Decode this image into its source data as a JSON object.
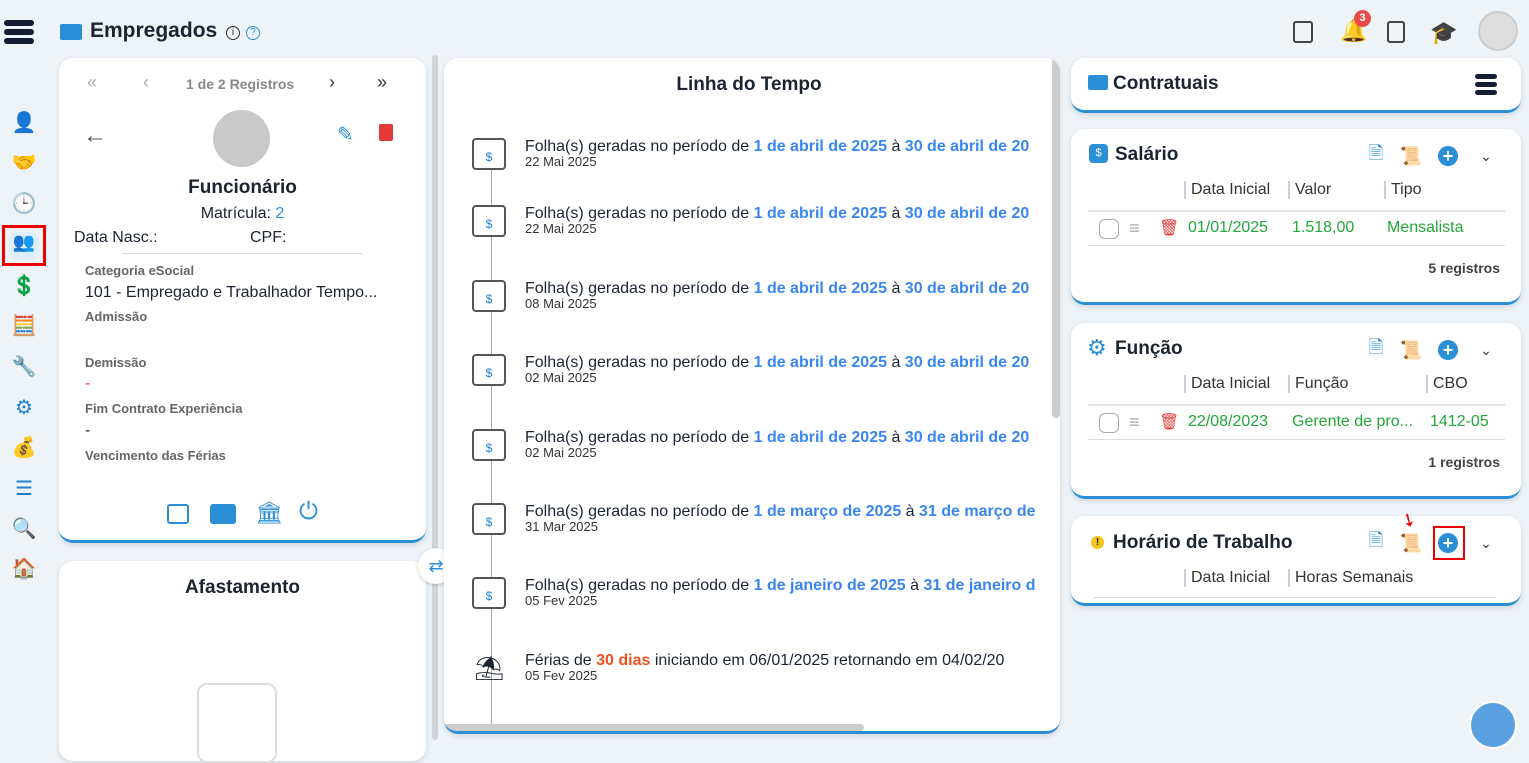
{
  "header": {
    "title": "Empregados",
    "notif_count": "3"
  },
  "employee": {
    "pager": "1 de 2 Registros",
    "role": "Funcionário",
    "matricula_label": "Matrícula:",
    "matricula": "2",
    "nasc_label": "Data Nasc.:",
    "cpf_label": "CPF:",
    "fields": [
      {
        "label": "Categoria eSocial",
        "value": "101 - Empregado e Trabalhador Tempo..."
      },
      {
        "label": "Admissão",
        "value": ""
      },
      {
        "label": "Demissão",
        "value": "-"
      },
      {
        "label": "Fim Contrato Experiência",
        "value": "-"
      },
      {
        "label": "Vencimento das Férias",
        "value": ""
      }
    ]
  },
  "afastamento": {
    "title": "Afastamento"
  },
  "timeline": {
    "title": "Linha do Tempo",
    "items": [
      {
        "pre": "Folha(s) geradas no período de ",
        "a": "1 de abril de 2025",
        "mid": " à ",
        "b": "30 de abril de 20",
        "date": "22 Mai 2025"
      },
      {
        "pre": "Folha(s) geradas no período de ",
        "a": "1 de abril de 2025",
        "mid": " à ",
        "b": "30 de abril de 20",
        "date": "22 Mai 2025"
      },
      {
        "pre": "Folha(s) geradas no período de ",
        "a": "1 de abril de 2025",
        "mid": " à ",
        "b": "30 de abril de 20",
        "date": "08 Mai 2025"
      },
      {
        "pre": "Folha(s) geradas no período de ",
        "a": "1 de abril de 2025",
        "mid": " à ",
        "b": "30 de abril de 20",
        "date": "02 Mai 2025"
      },
      {
        "pre": "Folha(s) geradas no período de ",
        "a": "1 de abril de 2025",
        "mid": " à ",
        "b": "30 de abril de 20",
        "date": "02 Mai 2025"
      },
      {
        "pre": "Folha(s) geradas no período de ",
        "a": "1 de março de 2025",
        "mid": " à ",
        "b": "31 de março de",
        "date": "31 Mar 2025"
      },
      {
        "pre": "Folha(s) geradas no período de ",
        "a": "1 de janeiro de 2025",
        "mid": " à ",
        "b": "31 de janeiro d",
        "date": "05 Fev 2025"
      }
    ],
    "ferias": {
      "pre": "Férias de ",
      "days": "30 dias",
      "post": " iniciando em 06/01/2025 retornando em 04/02/20",
      "date": "05 Fev 2025"
    }
  },
  "contratuais": {
    "title": "Contratuais"
  },
  "salario": {
    "title": "Salário",
    "headers": [
      "Data Inicial",
      "Valor",
      "Tipo"
    ],
    "row": [
      "01/01/2025",
      "1.518,00",
      "Mensalista"
    ],
    "count": "5 registros"
  },
  "funcao": {
    "title": "Função",
    "headers": [
      "Data Inicial",
      "Função",
      "CBO"
    ],
    "row": [
      "22/08/2023",
      "Gerente de pro...",
      "1412-05"
    ],
    "count": "1 registros"
  },
  "horario": {
    "title": "Horário de Trabalho",
    "headers": [
      "Data Inicial",
      "Horas Semanais"
    ]
  },
  "colors": {
    "accent": "#2b8fd8",
    "green": "#22a83a",
    "red": "#e53935",
    "link": "#3a86f0"
  }
}
